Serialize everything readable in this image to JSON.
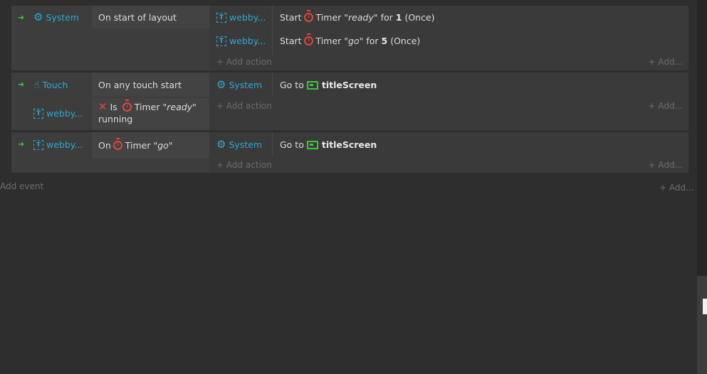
{
  "events": [
    {
      "condition": {
        "object": "System",
        "text": "On start of layout",
        "icon": "gear-icon"
      },
      "actions": [
        {
          "object": "webby...",
          "verb": "Start",
          "timer_label": "Timer",
          "timer_name": "\"ready\"",
          "for_label": "for",
          "value": "1",
          "mode": "(Once)"
        },
        {
          "object": "webby...",
          "verb": "Start",
          "timer_label": "Timer",
          "timer_name": "\"go\"",
          "for_label": "for",
          "value": "5",
          "mode": "(Once)"
        }
      ],
      "add_action": "+ Add action",
      "add_right": "+ Add..."
    },
    {
      "condition": {
        "object": "Touch",
        "text": "On any touch start",
        "icon": "touch-icon"
      },
      "condition2": {
        "object": "webby...",
        "is": "Is",
        "timer_label": "Timer",
        "timer_name": "\"ready\"",
        "tail": "running"
      },
      "actions": [
        {
          "object": "System",
          "verb": "Go to",
          "target": "titleScreen"
        }
      ],
      "add_action": "+ Add action",
      "add_right": "+ Add..."
    },
    {
      "condition": {
        "object": "webby...",
        "on": "On",
        "timer_label": "Timer",
        "timer_name": "\"go\""
      },
      "actions": [
        {
          "object": "System",
          "verb": "Go to",
          "target": "titleScreen"
        }
      ],
      "add_action": "+ Add action",
      "add_right": "+ Add..."
    }
  ],
  "footer": {
    "add_event": "Add event",
    "add_right": "+ Add..."
  }
}
